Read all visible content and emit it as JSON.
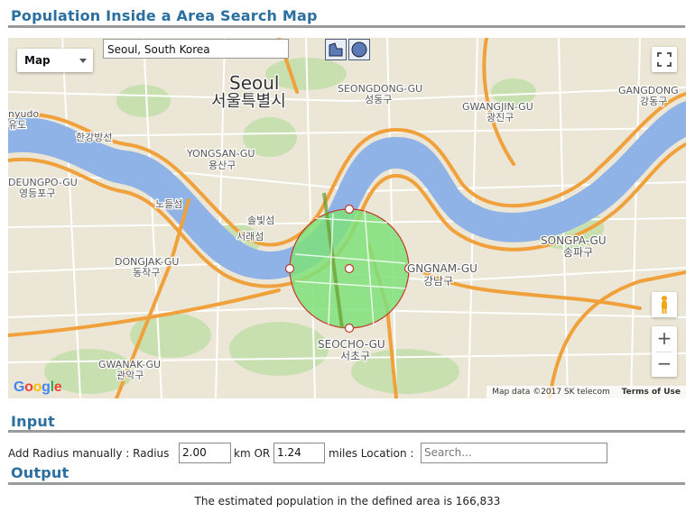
{
  "page": {
    "title": "Population Inside a Area Search Map",
    "input_title": "Input",
    "output_title": "Output"
  },
  "map": {
    "type_label": "Map",
    "location_value": "Seoul, South Korea",
    "draw_tools": [
      "polygon-draw-icon",
      "circle-draw-icon"
    ],
    "attribution": "Map data ©2017 SK telecom",
    "terms_label": "Terms of Use",
    "google_logo_text": "Google",
    "zoom_in_label": "+",
    "zoom_out_label": "−",
    "labels": {
      "seoul_en": "Seoul",
      "seoul_kr": "서울특별시",
      "seongdong_en": "SEONGDONG-GU",
      "seongdong_kr": "성동구",
      "gwangjin_en": "GWANGJIN-GU",
      "gwangjin_kr": "광진구",
      "gangdong_en": "GANGDONG",
      "gangdong_kr": "강동구",
      "yongsan_en": "YONGSAN-GU",
      "yongsan_kr": "용산구",
      "yeongdeungpo_en": "DEUNGPO-GU",
      "yeongdeungpo_kr": "영등포구",
      "hangang_kr": "한강방선",
      "nodeulseom_kr": "노들섬",
      "songpa_en": "SONGPA-GU",
      "songpa_kr": "송파구",
      "dongjak_en": "DONGJAK-GU",
      "dongjak_kr": "동작구",
      "gangnam_en": "GNGNAM-GU",
      "gangnam_kr": "강남구",
      "seocho_en": "SEOCHO-GU",
      "seocho_kr": "서초구",
      "gwanak_en": "GWANAK-GU",
      "gwanak_kr": "관악구",
      "mapo_en": "nyudo",
      "mapo_kr": "유도",
      "seobinggo_kr": "솔빛섬",
      "seorae_kr": "서래섬"
    },
    "colors": {
      "water": "#8fb3e6",
      "land": "#ece6d6",
      "park": "#c8e0b0",
      "road_major": "#f0a13c",
      "road_minor": "#ffffff",
      "circle_fill": "#7fe07a",
      "circle_stroke": "#c0392b"
    }
  },
  "input": {
    "prefix": "Add Radius manually : Radius",
    "radius_km": "2.00",
    "km_or_label": "km OR",
    "radius_miles": "1.24",
    "miles_location_label": "miles Location :",
    "location_placeholder": "Search..."
  },
  "output": {
    "result_text": "The estimated population in the defined area is 166,833"
  },
  "colors": {
    "heading": "#2a6fa0",
    "rule": "#9a9a9a"
  }
}
